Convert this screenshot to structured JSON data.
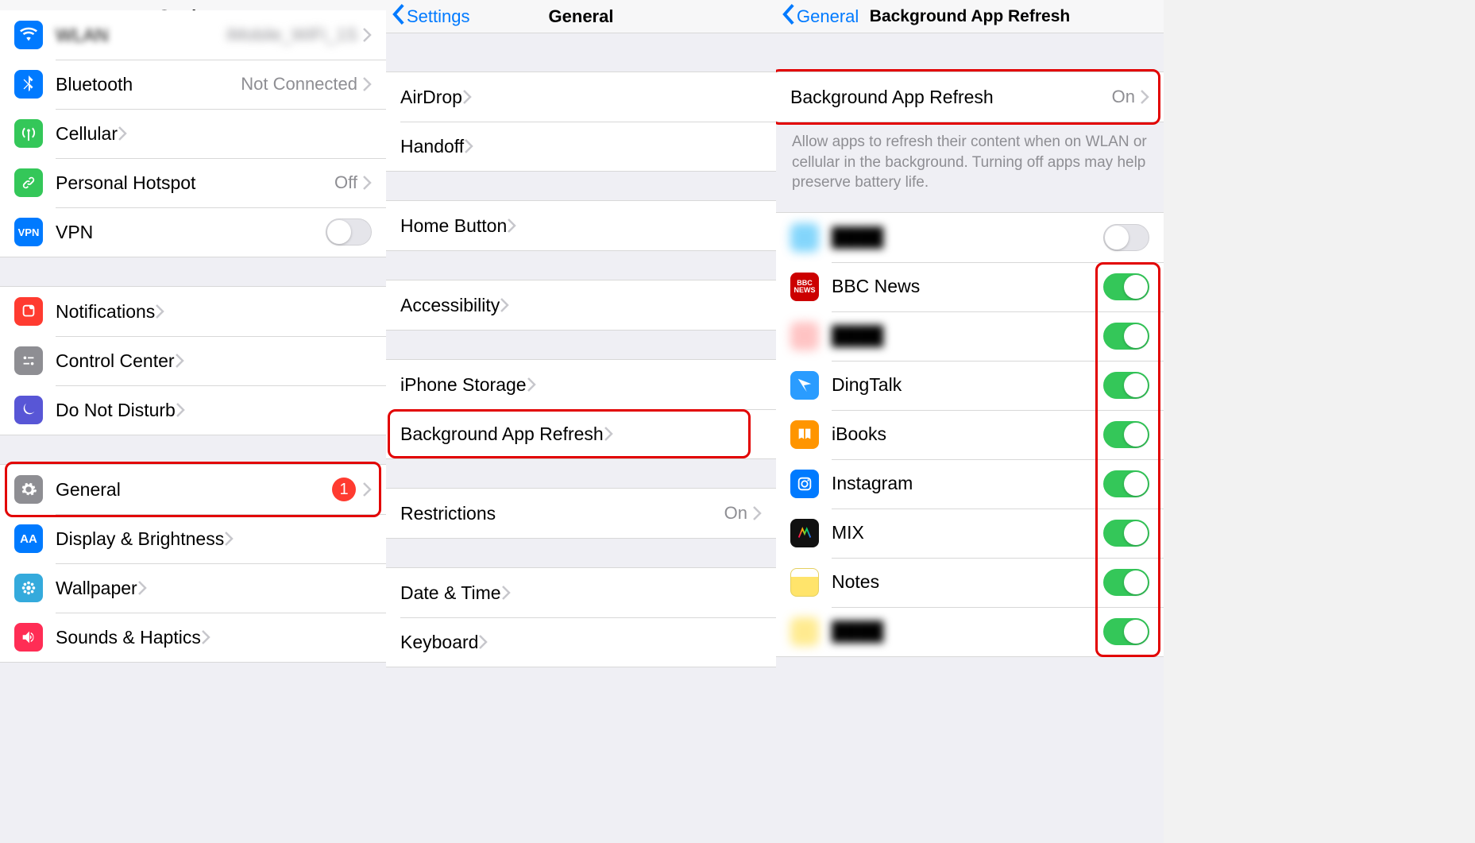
{
  "pane1": {
    "title": "Settings",
    "rows": [
      {
        "icon": "wifi",
        "iconColor": "#007aff",
        "label": "WLAN",
        "value": "iMobile_WiFi_1S",
        "blurred": true,
        "chevron": true
      },
      {
        "icon": "bluetooth",
        "iconColor": "#007aff",
        "label": "Bluetooth",
        "value": "Not Connected",
        "chevron": true
      },
      {
        "icon": "antenna",
        "iconColor": "#34c759",
        "label": "Cellular",
        "chevron": true
      },
      {
        "icon": "link",
        "iconColor": "#34c759",
        "label": "Personal Hotspot",
        "value": "Off",
        "chevron": true
      },
      {
        "icon": "vpn",
        "iconColor": "#007aff",
        "label": "VPN",
        "toggle": false
      }
    ],
    "rows2": [
      {
        "icon": "bell",
        "iconColor": "#ff3b30",
        "label": "Notifications",
        "chevron": true
      },
      {
        "icon": "cc",
        "iconColor": "#8e8e93",
        "label": "Control Center",
        "chevron": true
      },
      {
        "icon": "moon",
        "iconColor": "#5856d6",
        "label": "Do Not Disturb",
        "chevron": true
      }
    ],
    "rows3": [
      {
        "icon": "gear",
        "iconColor": "#8e8e93",
        "label": "General",
        "badge": "1",
        "chevron": true,
        "highlight": true
      },
      {
        "icon": "aa",
        "iconColor": "#007aff",
        "label": "Display & Brightness",
        "chevron": true
      },
      {
        "icon": "flower",
        "iconColor": "#34aadc",
        "label": "Wallpaper",
        "chevron": true
      },
      {
        "icon": "sound",
        "iconColor": "#ff2d55",
        "label": "Sounds & Haptics",
        "chevron": true
      }
    ]
  },
  "pane2": {
    "back": "Settings",
    "title": "General",
    "groups": [
      [
        {
          "label": "AirDrop",
          "chevron": true
        },
        {
          "label": "Handoff",
          "chevron": true
        }
      ],
      [
        {
          "label": "Home Button",
          "chevron": true
        }
      ],
      [
        {
          "label": "Accessibility",
          "chevron": true
        }
      ],
      [
        {
          "label": "iPhone Storage",
          "chevron": true
        },
        {
          "label": "Background App Refresh",
          "chevron": true,
          "highlight": true
        }
      ],
      [
        {
          "label": "Restrictions",
          "value": "On",
          "chevron": true
        }
      ],
      [
        {
          "label": "Date & Time",
          "chevron": true
        },
        {
          "label": "Keyboard",
          "chevron": true
        }
      ]
    ]
  },
  "pane3": {
    "back": "General",
    "title": "Background App Refresh",
    "master": {
      "label": "Background App Refresh",
      "value": "On",
      "chevron": true,
      "highlight": true
    },
    "description": "Allow apps to refresh their content when on WLAN or cellular in the background. Turning off apps may help preserve battery life.",
    "apps": [
      {
        "icon": "blur-blue",
        "label": "——",
        "toggle": false,
        "blurred": true
      },
      {
        "icon": "bbc",
        "label": "BBC News",
        "toggle": true
      },
      {
        "icon": "blur-pink",
        "label": "——",
        "toggle": true,
        "blurred": true
      },
      {
        "icon": "dingtalk",
        "label": "DingTalk",
        "toggle": true
      },
      {
        "icon": "ibooks",
        "label": "iBooks",
        "toggle": true
      },
      {
        "icon": "instagram",
        "label": "Instagram",
        "toggle": true
      },
      {
        "icon": "mix",
        "label": "MIX",
        "toggle": true
      },
      {
        "icon": "notes",
        "label": "Notes",
        "toggle": true
      },
      {
        "icon": "blur-yellow",
        "label": "——",
        "toggle": true,
        "blurred": true
      }
    ],
    "togglesHighlight": true
  }
}
